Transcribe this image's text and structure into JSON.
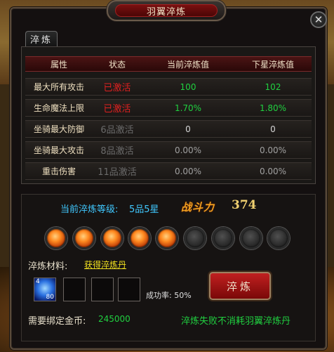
{
  "window": {
    "title": "羽翼淬炼",
    "close_glyph": "✕"
  },
  "tabs": [
    {
      "label": "淬炼",
      "active": true
    }
  ],
  "table": {
    "headers": [
      "属性",
      "状态",
      "当前淬炼值",
      "下星淬炼值"
    ],
    "rows": [
      {
        "attr": "最大所有攻击",
        "status": "已激活",
        "active": true,
        "current": "100",
        "next": "102"
      },
      {
        "attr": "生命魔法上限",
        "status": "已激活",
        "active": true,
        "current": "1.70%",
        "next": "1.80%"
      },
      {
        "attr": "坐骑最大防御",
        "status": "6品激活",
        "active": false,
        "current": "0",
        "next": "0"
      },
      {
        "attr": "坐骑最大攻击",
        "status": "8品激活",
        "active": false,
        "current": "0.00%",
        "next": "0.00%"
      },
      {
        "attr": "重击伤害",
        "status": "11品激活",
        "active": false,
        "current": "0.00%",
        "next": "0.00%"
      }
    ]
  },
  "level": {
    "label": "当前淬炼等级:",
    "value": "5品5星"
  },
  "power": {
    "label": "战斗力",
    "value": "374"
  },
  "stars": {
    "lit": 5,
    "total": 9,
    "icon": "orb-icon"
  },
  "materials": {
    "label": "淬炼材料:",
    "link": "获得淬炼丹",
    "slots": [
      {
        "item": "feather-pill-icon",
        "count_top": "4",
        "count_bottom": "80"
      },
      {
        "item": null
      },
      {
        "item": null
      },
      {
        "item": null
      }
    ]
  },
  "success_rate": {
    "label": "成功率:",
    "value": "50%"
  },
  "forge_button": {
    "label": "淬炼"
  },
  "gold": {
    "label": "需要绑定金币:",
    "value": "245000"
  },
  "note": "淬炼失败不消耗羽翼淬炼丹",
  "colors": {
    "active": "#e02020",
    "green": "#20d040",
    "blue": "#40c8ff",
    "power": "#f0a020"
  }
}
